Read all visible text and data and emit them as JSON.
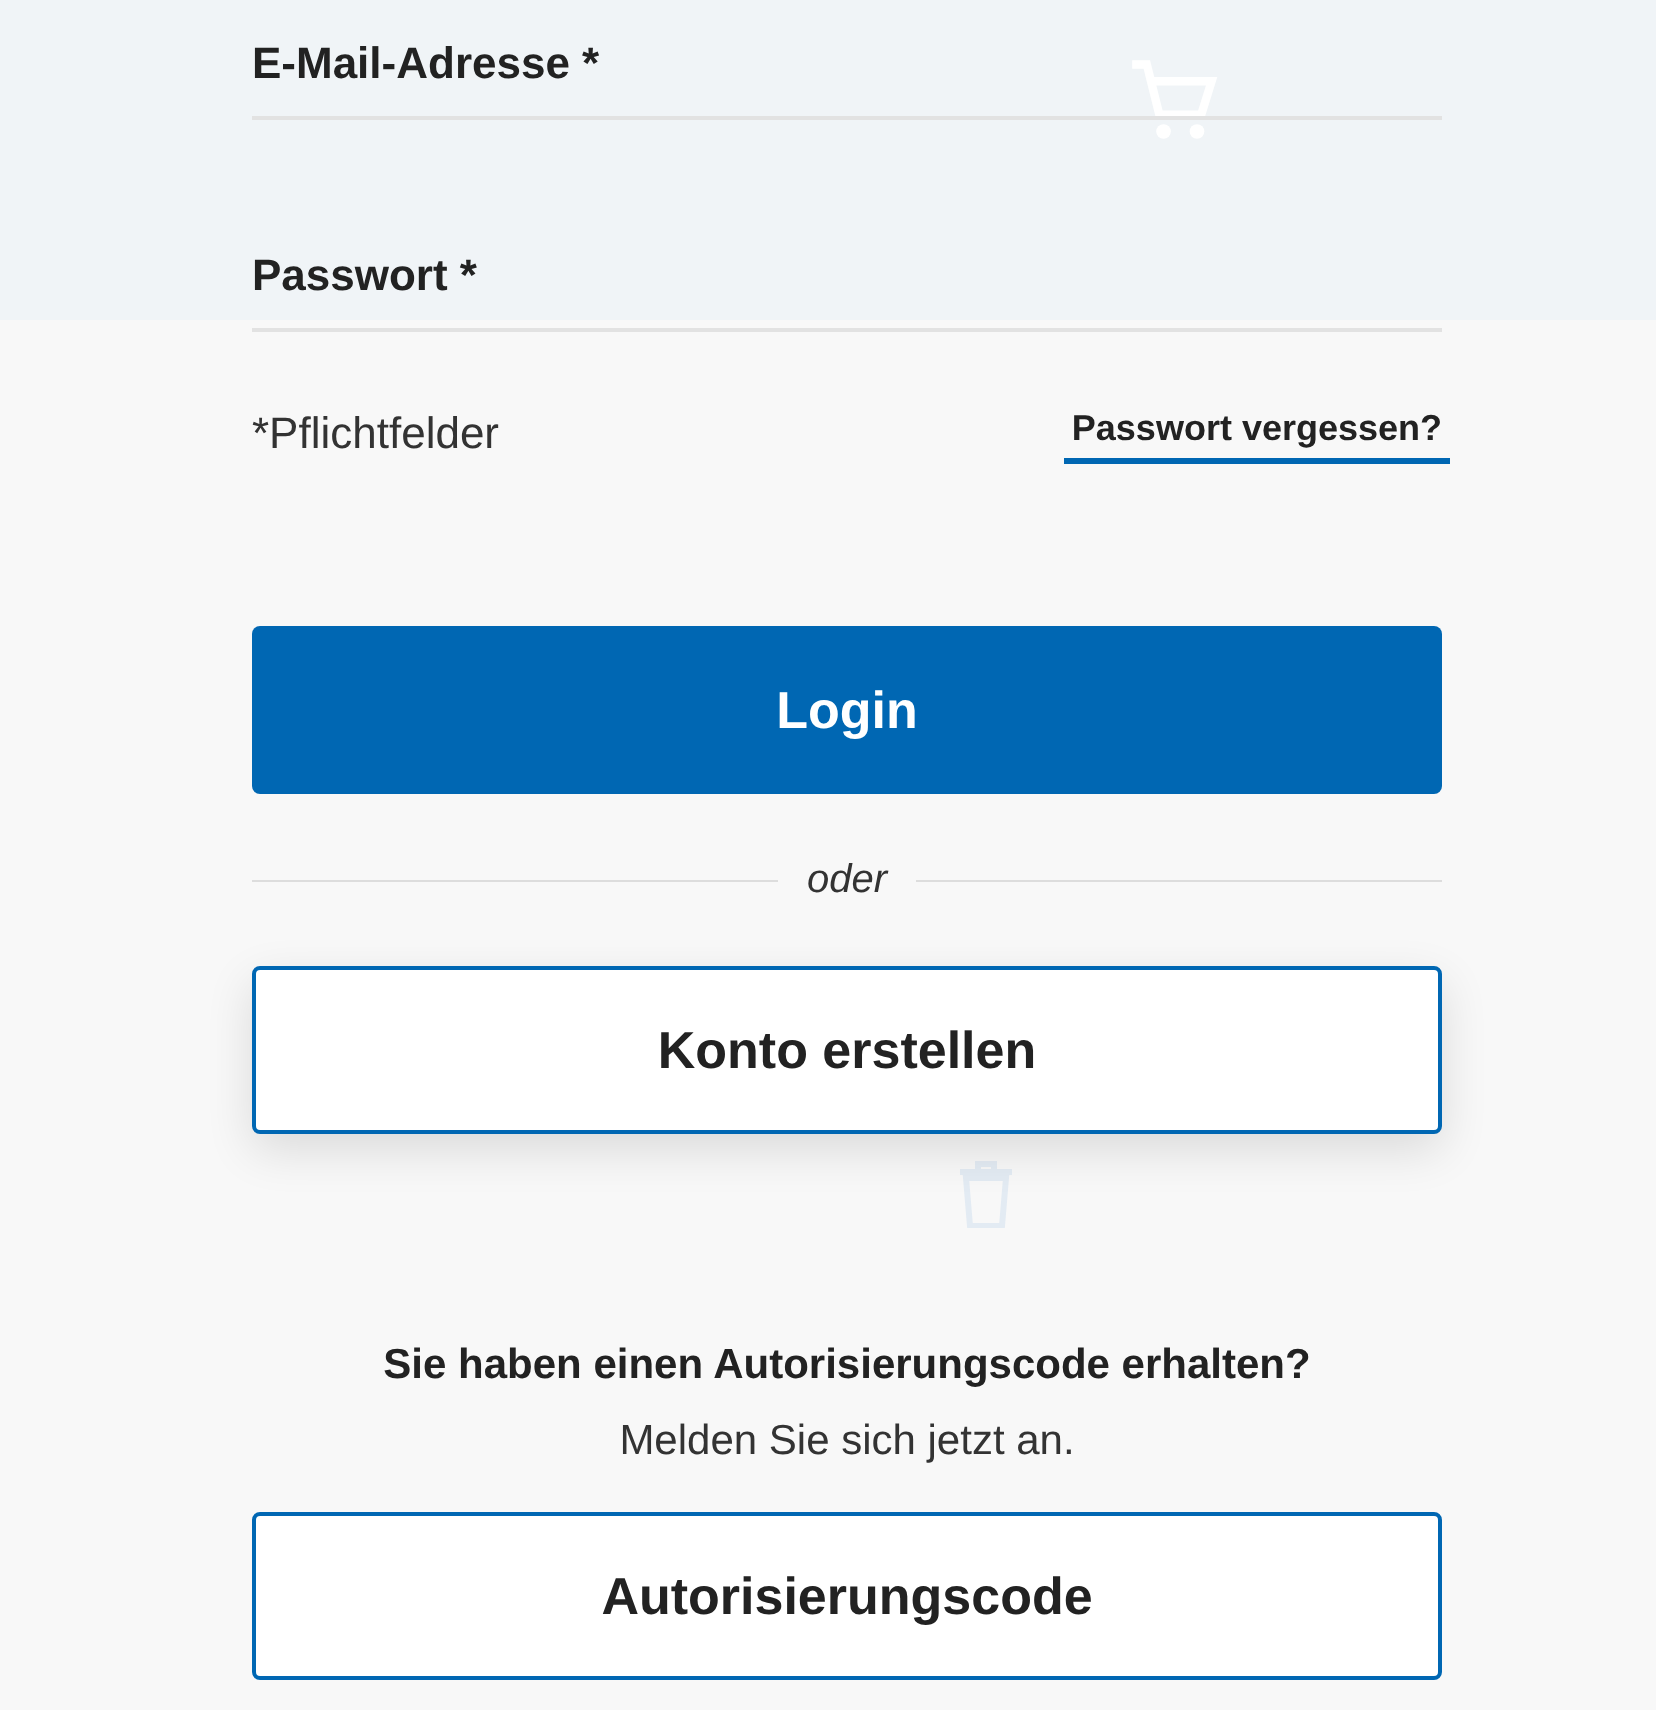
{
  "form": {
    "fields": [
      {
        "label": "E-Mail-Adresse *"
      },
      {
        "label": "Passwort *"
      }
    ],
    "required_note": "*Pflichtfelder",
    "forgot_link": "Passwort vergessen?",
    "login_button": "Login",
    "divider_text": "oder",
    "create_button": "Konto erstellen",
    "auth_prompt": {
      "title": "Sie haben einen Autorisierungscode erhalten?",
      "subtitle": "Melden Sie sich jetzt an."
    },
    "auth_button": "Autorisierungscode"
  }
}
